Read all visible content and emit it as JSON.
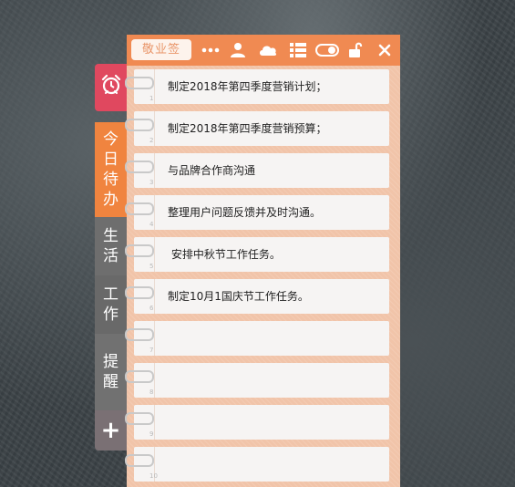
{
  "app": {
    "brand": "敬业签"
  },
  "toolbar": {
    "icons": [
      "more-icon",
      "user-icon",
      "cloud-icon",
      "list-icon",
      "toggle-icon",
      "unlock-icon",
      "close-icon"
    ]
  },
  "tabs": {
    "today": [
      "今",
      "日",
      "待",
      "办"
    ],
    "life": [
      "生",
      "活"
    ],
    "work": [
      "工",
      "作"
    ],
    "remind": [
      "提",
      "醒"
    ],
    "add": "+"
  },
  "notes": [
    {
      "num": "1",
      "text": "制定2018年第四季度营销计划；"
    },
    {
      "num": "2",
      "text": "制定2018年第四季度营销预算；"
    },
    {
      "num": "3",
      "text": "与品牌合作商沟通"
    },
    {
      "num": "4",
      "text": "整理用户问题反馈并及时沟通。"
    },
    {
      "num": "5",
      "text": " 安排中秋节工作任务。"
    },
    {
      "num": "6",
      "text": "制定10月1国庆节工作任务。"
    },
    {
      "num": "7",
      "text": ""
    },
    {
      "num": "8",
      "text": ""
    },
    {
      "num": "9",
      "text": ""
    },
    {
      "num": "10",
      "text": ""
    }
  ],
  "colors": {
    "accent": "#f08a52",
    "alarm": "#e0485f",
    "panel": "#f1c4a9"
  }
}
